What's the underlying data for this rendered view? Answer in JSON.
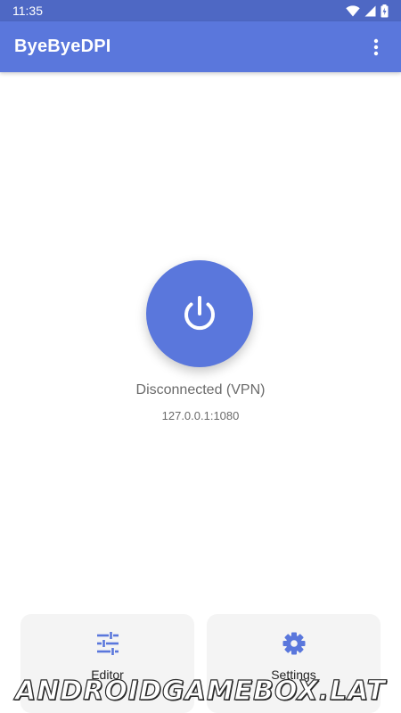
{
  "status_bar": {
    "time": "11:35"
  },
  "app_bar": {
    "title": "ByeByeDPI",
    "menu_icon": "more-vert-icon"
  },
  "main": {
    "power_icon": "power-icon",
    "status": "Disconnected (VPN)",
    "address": "127.0.0.1:1080"
  },
  "cards": {
    "editor": {
      "label": "Editor",
      "icon": "tune-icon"
    },
    "settings": {
      "label": "Settings",
      "icon": "gear-icon"
    }
  },
  "watermark": "ANDROIDGAMEBOX.LAT",
  "colors": {
    "primary": "#5a77dc",
    "status_bar": "#4e68c4",
    "card_bg": "#f4f4f4",
    "muted_text": "#6b6b6b"
  }
}
